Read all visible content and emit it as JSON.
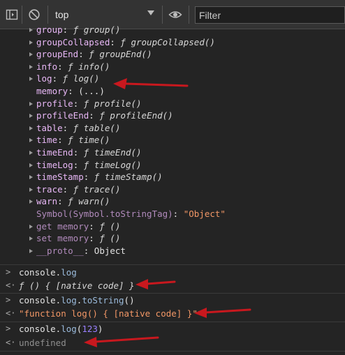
{
  "toolbar": {
    "context_label": "top",
    "filter_placeholder": "Filter",
    "icons": [
      "sidebar-toggle-icon",
      "clear-console-icon",
      "dropdown-caret-icon",
      "eye-icon"
    ]
  },
  "properties": [
    {
      "key": "group",
      "sep": ":",
      "prefix": "ƒ ",
      "value": "group()",
      "kind": "fn",
      "expandable": true
    },
    {
      "key": "groupCollapsed",
      "sep": ":",
      "prefix": "ƒ ",
      "value": "groupCollapsed()",
      "kind": "fn",
      "expandable": true
    },
    {
      "key": "groupEnd",
      "sep": ":",
      "prefix": "ƒ ",
      "value": "groupEnd()",
      "kind": "fn",
      "expandable": true
    },
    {
      "key": "info",
      "sep": ":",
      "prefix": "ƒ ",
      "value": "info()",
      "kind": "fn",
      "expandable": true
    },
    {
      "key": "log",
      "sep": ":",
      "prefix": "ƒ ",
      "value": "log()",
      "kind": "fn",
      "expandable": true
    },
    {
      "key": "memory",
      "sep": ":",
      "prefix": "",
      "value": "(...)",
      "kind": "plain",
      "expandable": false
    },
    {
      "key": "profile",
      "sep": ":",
      "prefix": "ƒ ",
      "value": "profile()",
      "kind": "fn",
      "expandable": true
    },
    {
      "key": "profileEnd",
      "sep": ":",
      "prefix": "ƒ ",
      "value": "profileEnd()",
      "kind": "fn",
      "expandable": true
    },
    {
      "key": "table",
      "sep": ":",
      "prefix": "ƒ ",
      "value": "table()",
      "kind": "fn",
      "expandable": true
    },
    {
      "key": "time",
      "sep": ":",
      "prefix": "ƒ ",
      "value": "time()",
      "kind": "fn",
      "expandable": true
    },
    {
      "key": "timeEnd",
      "sep": ":",
      "prefix": "ƒ ",
      "value": "timeEnd()",
      "kind": "fn",
      "expandable": true
    },
    {
      "key": "timeLog",
      "sep": ":",
      "prefix": "ƒ ",
      "value": "timeLog()",
      "kind": "fn",
      "expandable": true
    },
    {
      "key": "timeStamp",
      "sep": ":",
      "prefix": "ƒ ",
      "value": "timeStamp()",
      "kind": "fn",
      "expandable": true
    },
    {
      "key": "trace",
      "sep": ":",
      "prefix": "ƒ ",
      "value": "trace()",
      "kind": "fn",
      "expandable": true
    },
    {
      "key": "warn",
      "sep": ":",
      "prefix": "ƒ ",
      "value": "warn()",
      "kind": "fn",
      "expandable": true
    },
    {
      "key": "Symbol(Symbol.toStringTag)",
      "sep": ": ",
      "prefix": "",
      "value": "\"Object\"",
      "kind": "str",
      "expandable": false,
      "dim": true
    },
    {
      "key": "get memory",
      "sep": ":",
      "prefix": "ƒ ",
      "value": "()",
      "kind": "fn",
      "expandable": true,
      "dim": true
    },
    {
      "key": "set memory",
      "sep": ":",
      "prefix": "ƒ ",
      "value": "()",
      "kind": "fn",
      "expandable": true,
      "dim": true
    },
    {
      "key": "__proto__",
      "sep": ":",
      "prefix": " ",
      "value": "Object",
      "kind": "plain",
      "expandable": true,
      "dim": true
    }
  ],
  "console": {
    "input1": {
      "obj": "console.",
      "method": "log"
    },
    "output1": {
      "text": "ƒ () { [native code] }"
    },
    "input2": {
      "obj": "console.",
      "method": "log",
      "dot": ".",
      "method2": "toString",
      "args": "()"
    },
    "output2": {
      "text": "\"function log() { [native code] }\""
    },
    "input3": {
      "obj": "console.",
      "method": "log",
      "paren_open": "(",
      "num": "123",
      "paren_close": ")"
    },
    "output3": {
      "text": "undefined"
    },
    "prompt_symbol": ">",
    "result_symbol": "<·"
  },
  "colors": {
    "background": "#242424",
    "toolbar": "#333333",
    "key": "#e9b8f7",
    "string": "#f29766",
    "method": "#9bbbdc",
    "number": "#9980ff",
    "annotation_arrow": "#c8181e"
  }
}
